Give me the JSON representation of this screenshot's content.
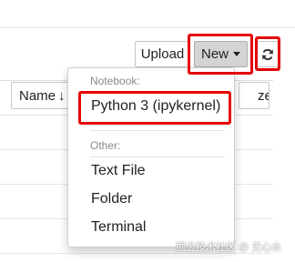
{
  "toolbar": {
    "upload_label": "Upload",
    "new_label": "New",
    "refresh_icon": "refresh-icon"
  },
  "columns": {
    "name_label": "Name",
    "sort_icon": "arrow-down-icon",
    "size_label": "ze"
  },
  "new_menu": {
    "notebook_header": "Notebook:",
    "python_kernel": "Python 3 (ipykernel)",
    "other_header": "Other:",
    "text_file": "Text File",
    "folder": "Folder",
    "terminal": "Terminal"
  },
  "watermark": "掘金技术社区 @ 无心水",
  "colors": {
    "highlight_red": "#e50000",
    "new_button_bg": "#d4d4d4"
  }
}
